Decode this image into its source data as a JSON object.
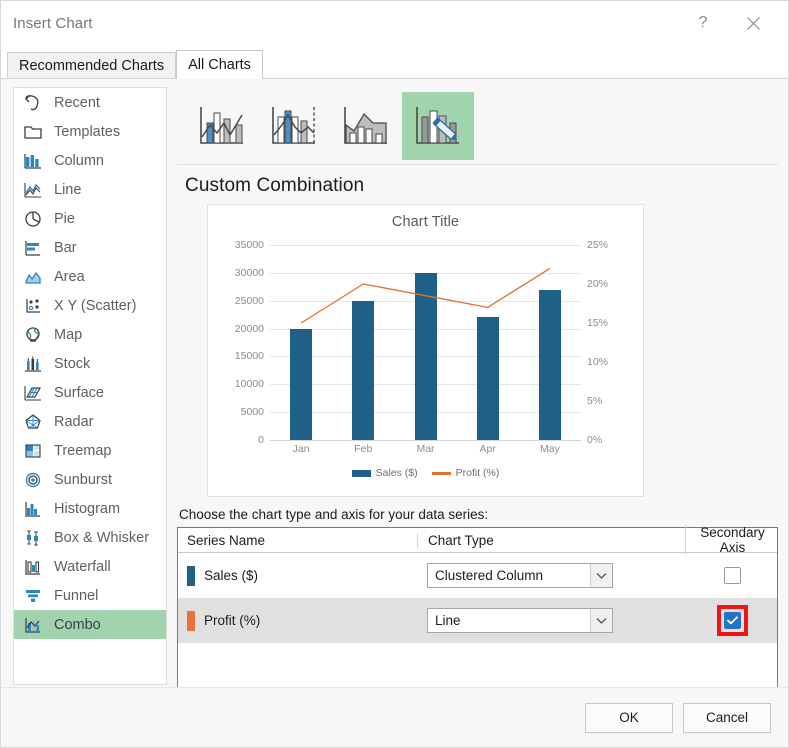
{
  "window": {
    "title": "Insert Chart",
    "help_label": "?",
    "close_label": "×"
  },
  "tabs": [
    {
      "label": "Recommended Charts",
      "active": false
    },
    {
      "label": "All Charts",
      "active": true
    }
  ],
  "sidebar": {
    "items": [
      {
        "label": "Recent",
        "icon": "recent-icon",
        "selected": false
      },
      {
        "label": "Templates",
        "icon": "templates-icon",
        "selected": false
      },
      {
        "label": "Column",
        "icon": "column-icon",
        "selected": false
      },
      {
        "label": "Line",
        "icon": "line-icon",
        "selected": false
      },
      {
        "label": "Pie",
        "icon": "pie-icon",
        "selected": false
      },
      {
        "label": "Bar",
        "icon": "bar-icon",
        "selected": false
      },
      {
        "label": "Area",
        "icon": "area-icon",
        "selected": false
      },
      {
        "label": "X Y (Scatter)",
        "icon": "scatter-icon",
        "selected": false
      },
      {
        "label": "Map",
        "icon": "map-icon",
        "selected": false
      },
      {
        "label": "Stock",
        "icon": "stock-icon",
        "selected": false
      },
      {
        "label": "Surface",
        "icon": "surface-icon",
        "selected": false
      },
      {
        "label": "Radar",
        "icon": "radar-icon",
        "selected": false
      },
      {
        "label": "Treemap",
        "icon": "treemap-icon",
        "selected": false
      },
      {
        "label": "Sunburst",
        "icon": "sunburst-icon",
        "selected": false
      },
      {
        "label": "Histogram",
        "icon": "histogram-icon",
        "selected": false
      },
      {
        "label": "Box & Whisker",
        "icon": "box-whisker-icon",
        "selected": false
      },
      {
        "label": "Waterfall",
        "icon": "waterfall-icon",
        "selected": false
      },
      {
        "label": "Funnel",
        "icon": "funnel-icon",
        "selected": false
      },
      {
        "label": "Combo",
        "icon": "combo-icon",
        "selected": true
      }
    ]
  },
  "thumbnails": [
    {
      "name": "clustered-column-line",
      "selected": false
    },
    {
      "name": "clustered-column-line-on-secondary-axis",
      "selected": false
    },
    {
      "name": "stacked-area-clustered-column",
      "selected": false
    },
    {
      "name": "custom-combination",
      "selected": true
    }
  ],
  "preview": {
    "heading": "Custom Combination"
  },
  "chart_data": {
    "type": "bar",
    "title": "Chart Title",
    "categories": [
      "Jan",
      "Feb",
      "Mar",
      "Apr",
      "May"
    ],
    "series": [
      {
        "name": "Sales ($)",
        "chart_type": "bar",
        "axis": "primary",
        "color": "#1f6087",
        "values": [
          19900,
          25000,
          30000,
          22000,
          27000
        ]
      },
      {
        "name": "Profit (%)",
        "chart_type": "line",
        "axis": "secondary",
        "color": "#e4702e",
        "values": [
          15,
          20,
          18.5,
          17,
          22
        ]
      }
    ],
    "xlabel": "",
    "ylabel": "",
    "ylim": [
      0,
      35000
    ],
    "y_ticks": [
      "35000",
      "30000",
      "25000",
      "20000",
      "15000",
      "10000",
      "5000",
      "0"
    ],
    "y2label": "",
    "y2lim": [
      0,
      25
    ],
    "y2_ticks": [
      "25%",
      "20%",
      "15%",
      "10%",
      "5%",
      "0%"
    ],
    "grid": true,
    "legend": "bottom",
    "legend_entries": [
      "Sales ($)",
      "Profit (%)"
    ]
  },
  "series_panel": {
    "instruction": "Choose the chart type and axis for your data series:",
    "headers": {
      "series_name": "Series Name",
      "chart_type": "Chart Type",
      "secondary_axis": "Secondary Axis"
    },
    "rows": [
      {
        "series_name": "Sales ($)",
        "swatch_color": "#1f6087",
        "chart_type": "Clustered Column",
        "secondary_axis_checked": false,
        "highlighted": false
      },
      {
        "series_name": "Profit (%)",
        "swatch_color": "#e8743c",
        "chart_type": "Line",
        "secondary_axis_checked": true,
        "highlighted": true
      }
    ]
  },
  "footer": {
    "ok_label": "OK",
    "cancel_label": "Cancel"
  },
  "colors": {
    "selection_green": "#a1d4ae",
    "highlight_red": "#f01414",
    "checkbox_blue": "#2474c4",
    "series_blue": "#1f6087",
    "series_orange": "#e4702e"
  }
}
